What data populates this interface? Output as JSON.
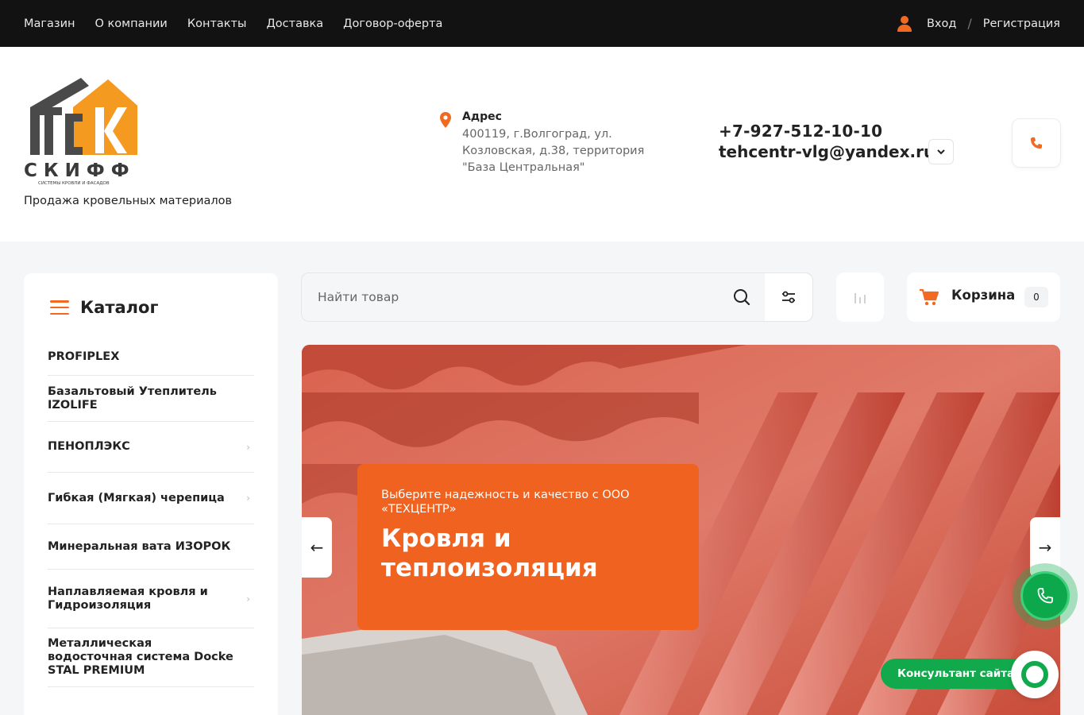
{
  "topnav": {
    "items": [
      "Магазин",
      "О компании",
      "Контакты",
      "Доставка",
      "Договор-оферта"
    ]
  },
  "auth": {
    "login": "Вход",
    "separator": "/",
    "register": "Регистрация"
  },
  "header": {
    "logo_text": "СКИФФ",
    "logo_subtext": "СИСТЕМЫ КРОВЛИ И ФАСАДОВ",
    "tagline": "Продажа кровельных материалов",
    "address_title": "Адрес",
    "address_text": "400119, г.Волгоград, ул. Козловская, д.38, территория \"База Центральная\"",
    "phone": "+7-927-512-10-10",
    "email": "tehcentr-vlg@yandex.ru"
  },
  "catalog": {
    "title": "Каталог",
    "items": [
      {
        "label": "PROFIPLEX",
        "has_children": false
      },
      {
        "label": "Базальтовый Утеплитель IZOLIFE",
        "has_children": false
      },
      {
        "label": "ПЕНОПЛЭКС",
        "has_children": true
      },
      {
        "label": "Гибкая (Мягкая) черепица",
        "has_children": true
      },
      {
        "label": "Минеральная вата ИЗОРОК",
        "has_children": false
      },
      {
        "label": "Наплавляемая кровля и Гидроизоляция",
        "has_children": true
      },
      {
        "label": "Металлическая водосточная система Docke STAL PREMIUM",
        "has_children": false
      }
    ]
  },
  "search": {
    "placeholder": "Найти товар"
  },
  "cart": {
    "label": "Корзина",
    "count": "0"
  },
  "banner": {
    "subtitle": "Выберите надежность и качество с ООО «ТЕХЦЕНТР»",
    "title": "Кровля и теплоизоляция"
  },
  "widgets": {
    "consultant_label": "Консультант сайта"
  },
  "colors": {
    "accent": "#f26a21",
    "promo": "#f0621f",
    "green": "#12a94d",
    "topbar": "#121212"
  }
}
